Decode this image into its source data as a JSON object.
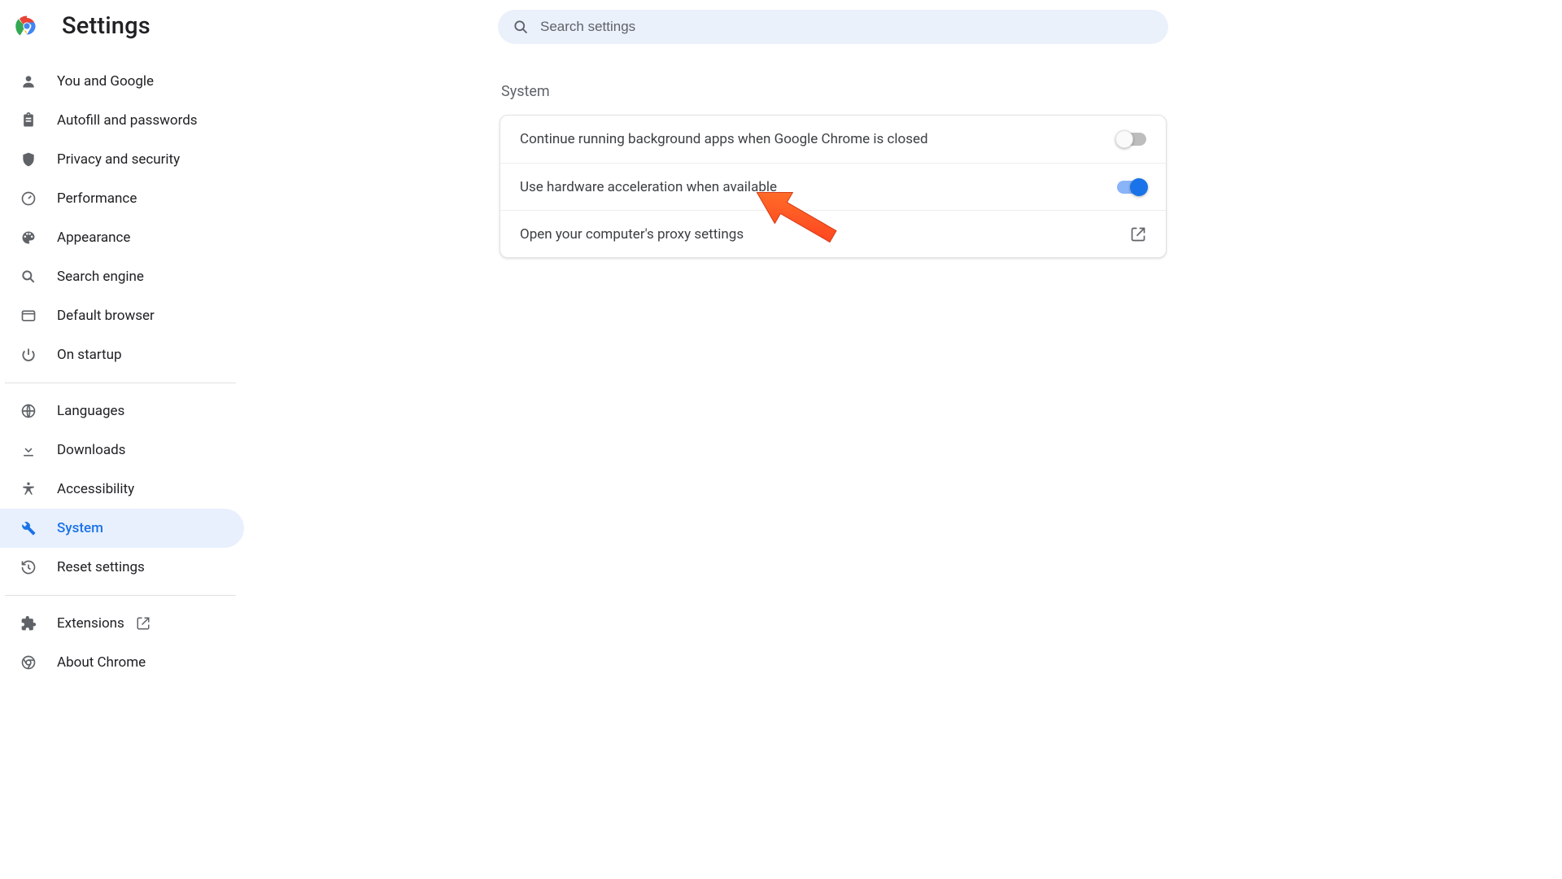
{
  "app": {
    "title": "Settings"
  },
  "search": {
    "placeholder": "Search settings"
  },
  "sidebar": {
    "group1": [
      {
        "label": "You and Google"
      },
      {
        "label": "Autofill and passwords"
      },
      {
        "label": "Privacy and security"
      },
      {
        "label": "Performance"
      },
      {
        "label": "Appearance"
      },
      {
        "label": "Search engine"
      },
      {
        "label": "Default browser"
      },
      {
        "label": "On startup"
      }
    ],
    "group2": [
      {
        "label": "Languages"
      },
      {
        "label": "Downloads"
      },
      {
        "label": "Accessibility"
      },
      {
        "label": "System"
      },
      {
        "label": "Reset settings"
      }
    ],
    "group3": [
      {
        "label": "Extensions"
      },
      {
        "label": "About Chrome"
      }
    ]
  },
  "main": {
    "section_title": "System",
    "rows": [
      {
        "label": "Continue running background apps when Google Chrome is closed",
        "toggle": false
      },
      {
        "label": "Use hardware acceleration when available",
        "toggle": true
      },
      {
        "label": "Open your computer's proxy settings"
      }
    ]
  },
  "colors": {
    "accent": "#1a73e8",
    "surface": "#e8f0fe"
  }
}
